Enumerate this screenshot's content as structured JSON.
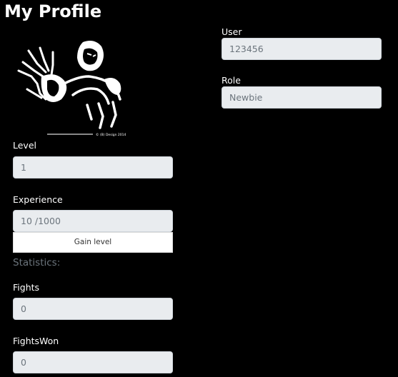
{
  "page": {
    "title": "My Profile"
  },
  "avatar": {
    "caption": "© (B) Design 2014"
  },
  "user": {
    "label": "User",
    "value": "123456"
  },
  "role": {
    "label": "Role",
    "value": "Newbie"
  },
  "level": {
    "label": "Level",
    "value": "1"
  },
  "experience": {
    "label": "Experience",
    "value": "10 /1000",
    "button_label": "Gain level"
  },
  "statistics": {
    "heading": "Statistics:",
    "fights_label": "Fights",
    "fights_value": "0",
    "fights_won_label": "FightsWon",
    "fights_won_value": "0"
  },
  "colors": {
    "background": "#000000",
    "text": "#ffffff",
    "field_background": "#e9ecef",
    "field_text": "#6c757d",
    "muted_heading": "#6c757d"
  }
}
